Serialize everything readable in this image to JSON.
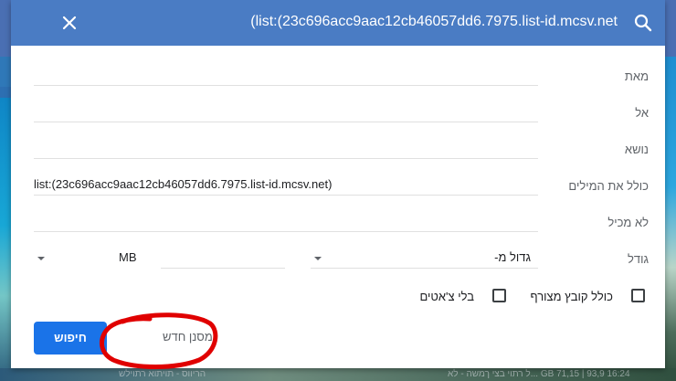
{
  "header": {
    "query": "(list:(23c696acc9aac12cb46057dd6.7975.list-id.mcsv.net",
    "search_icon": "search-icon",
    "close_icon": "close-icon"
  },
  "form": {
    "from": {
      "label": "מאת",
      "value": ""
    },
    "to": {
      "label": "אל",
      "value": ""
    },
    "subject": {
      "label": "נושא",
      "value": ""
    },
    "has_words": {
      "label": "כולל את המילים",
      "value": "list:(23c696acc9aac12cb46057dd6.7975.list-id.mcsv.net)"
    },
    "doesnt_have": {
      "label": "לא מכיל",
      "value": ""
    },
    "size": {
      "label": "גודל",
      "operator": "גדול מ-",
      "amount": "",
      "unit": "MB"
    },
    "has_attachment": {
      "label": "כולל קובץ מצורף",
      "checked": false
    },
    "no_chats": {
      "label": "בלי צ'אטים",
      "checked": false
    }
  },
  "actions": {
    "search": "חיפוש",
    "create_filter": "מסנן חדש"
  },
  "background": {
    "bottom_left": "הריווס - תויתוא רתוילש",
    "bottom_right": "16:24 GB 71,15 | 93,9 ...ל רתוי בצי ךמשה - לא"
  },
  "annotation_color": "#e00000"
}
